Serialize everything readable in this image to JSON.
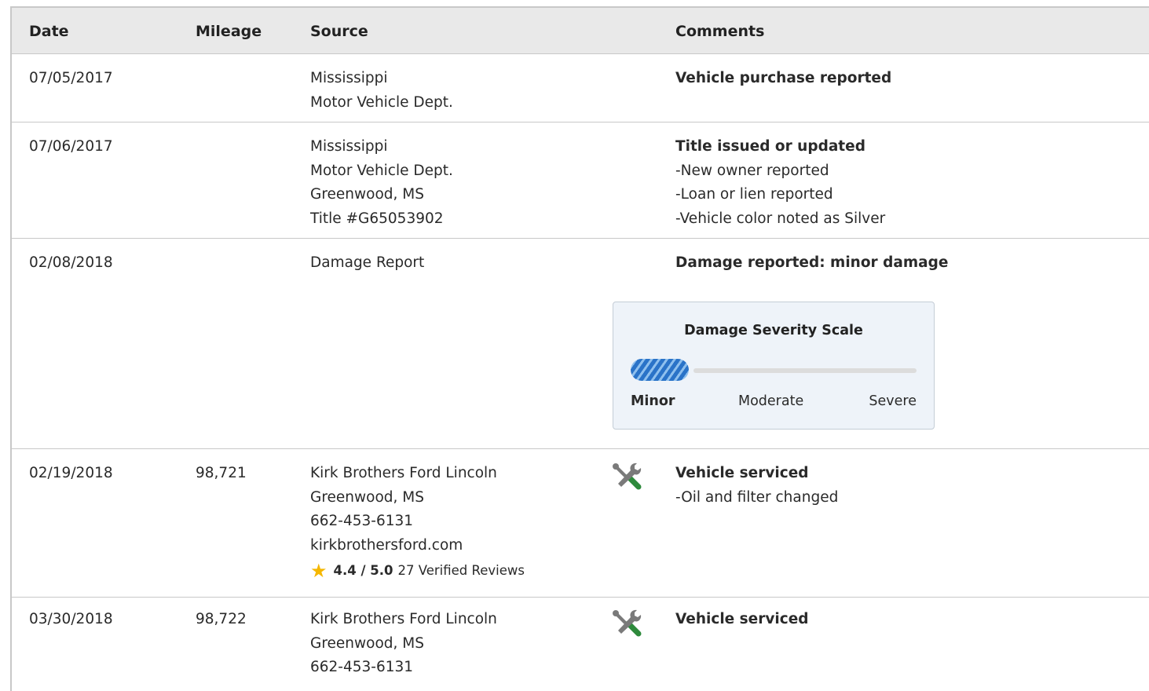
{
  "table": {
    "headers": {
      "date": "Date",
      "mileage": "Mileage",
      "source": "Source",
      "comments": "Comments"
    },
    "rows": [
      {
        "date": "07/05/2017",
        "mileage": "",
        "source": [
          "Mississippi",
          "Motor Vehicle Dept."
        ],
        "comment_title": "Vehicle purchase reported",
        "comment_lines": []
      },
      {
        "date": "07/06/2017",
        "mileage": "",
        "source": [
          "Mississippi",
          "Motor Vehicle Dept.",
          "Greenwood, MS",
          "Title #G65053902"
        ],
        "comment_title": "Title issued or updated",
        "comment_lines": [
          "-New owner reported",
          "-Loan or lien reported",
          "-Vehicle color noted as Silver"
        ]
      },
      {
        "date": "02/08/2018",
        "mileage": "",
        "source": [
          "Damage Report"
        ],
        "comment_title": "Damage reported: minor damage",
        "comment_lines": [],
        "severity": {
          "title": "Damage Severity Scale",
          "level": "Minor",
          "level_fraction": 0.25,
          "labels": [
            "Minor",
            "Moderate",
            "Severe"
          ],
          "fill_color": "#2a73c8"
        }
      },
      {
        "date": "02/19/2018",
        "mileage": "98,721",
        "source": [
          "Kirk Brothers Ford Lincoln",
          "Greenwood, MS",
          "662-453-6131",
          "kirkbrothersford.com"
        ],
        "rating": {
          "score": "4.4 / 5.0",
          "reviews": "27 Verified Reviews"
        },
        "icon": "wrench-screwdriver-icon",
        "comment_title": "Vehicle serviced",
        "comment_lines": [
          "-Oil and filter changed"
        ]
      },
      {
        "date": "03/30/2018",
        "mileage": "98,722",
        "source": [
          "Kirk Brothers Ford Lincoln",
          "Greenwood, MS",
          "662-453-6131"
        ],
        "icon": "wrench-screwdriver-icon",
        "comment_title": "Vehicle serviced",
        "comment_lines": []
      }
    ]
  },
  "colors": {
    "header_bg": "#e9e9e9",
    "border": "#c8c8c8",
    "star": "#f5b700",
    "service_icon_green": "#2e8a3c"
  }
}
